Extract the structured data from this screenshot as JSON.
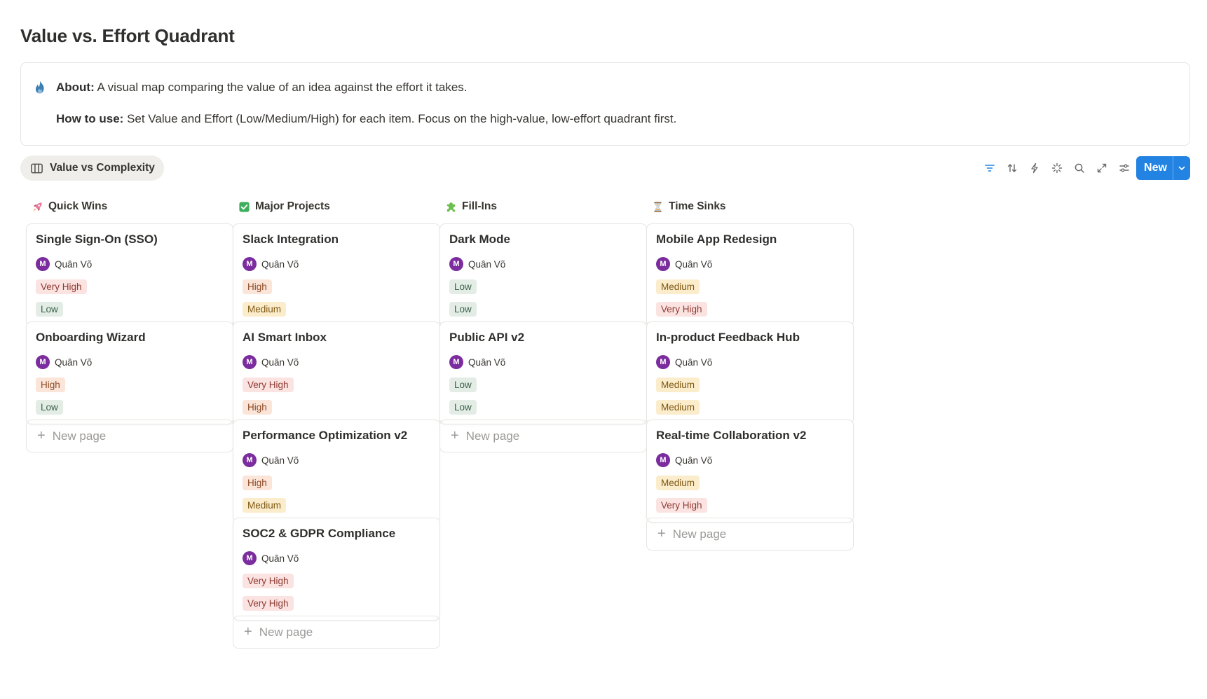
{
  "page": {
    "title": "Value vs. Effort Quadrant"
  },
  "callout": {
    "about_label": "About:",
    "about_text": " A visual map comparing the value of an idea against the effort it takes.",
    "howto_label": "How to use:",
    "howto_text": " Set Value and Effort (Low/Medium/High) for each item. Focus on the high-value, low-effort quadrant first."
  },
  "view": {
    "tab_label": "Value vs Complexity"
  },
  "toolbar": {
    "new_label": "New"
  },
  "colors": {
    "accent": "#2383e2",
    "avatar": "#7b2c9e",
    "very_high": "#fbe3e1",
    "high": "#fbe4d8",
    "medium": "#fbeccb",
    "low": "#e3ede6"
  },
  "new_page_label": "New page",
  "columns": [
    {
      "name": "Quick Wins",
      "icon": "rocket-icon",
      "cards": [
        {
          "title": "Single Sign-On (SSO)",
          "person": "Quân Võ",
          "initial": "M",
          "value": "Very High",
          "effort": "Low"
        },
        {
          "title": "Onboarding Wizard",
          "person": "Quân Võ",
          "initial": "M",
          "value": "High",
          "effort": "Low"
        }
      ]
    },
    {
      "name": "Major Projects",
      "icon": "check-mark-icon",
      "cards": [
        {
          "title": "Slack Integration",
          "person": "Quân Võ",
          "initial": "M",
          "value": "High",
          "effort": "Medium"
        },
        {
          "title": "AI Smart Inbox",
          "person": "Quân Võ",
          "initial": "M",
          "value": "Very High",
          "effort": "High"
        },
        {
          "title": "Performance Optimization v2",
          "person": "Quân Võ",
          "initial": "M",
          "value": "High",
          "effort": "Medium"
        },
        {
          "title": "SOC2 & GDPR Compliance",
          "person": "Quân Võ",
          "initial": "M",
          "value": "Very High",
          "effort": "Very High"
        }
      ]
    },
    {
      "name": "Fill-Ins",
      "icon": "puzzle-icon",
      "cards": [
        {
          "title": "Dark Mode",
          "person": "Quân Võ",
          "initial": "M",
          "value": "Low",
          "effort": "Low"
        },
        {
          "title": "Public API v2",
          "person": "Quân Võ",
          "initial": "M",
          "value": "Low",
          "effort": "Low"
        }
      ]
    },
    {
      "name": "Time Sinks",
      "icon": "hourglass-icon",
      "cards": [
        {
          "title": "Mobile App Redesign",
          "person": "Quân Võ",
          "initial": "M",
          "value": "Medium",
          "effort": "Very High"
        },
        {
          "title": "In-product Feedback Hub",
          "person": "Quân Võ",
          "initial": "M",
          "value": "Medium",
          "effort": "Medium"
        },
        {
          "title": "Real-time Collaboration v2",
          "person": "Quân Võ",
          "initial": "M",
          "value": "Medium",
          "effort": "Very High"
        }
      ]
    }
  ]
}
